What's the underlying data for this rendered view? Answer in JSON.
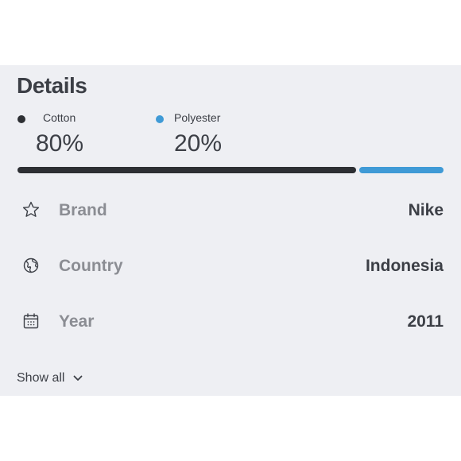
{
  "section_title": "Details",
  "composition": [
    {
      "name": "Cotton",
      "percent_label": "80%",
      "value": 80,
      "color": "#2d2f33"
    },
    {
      "name": "Polyester",
      "percent_label": "20%",
      "value": 20,
      "color": "#3f9ad6"
    }
  ],
  "attributes": [
    {
      "icon": "star-icon",
      "label": "Brand",
      "value": "Nike"
    },
    {
      "icon": "globe-icon",
      "label": "Country",
      "value": "Indonesia"
    },
    {
      "icon": "calendar-icon",
      "label": "Year",
      "value": "2011"
    }
  ],
  "show_all_label": "Show all"
}
